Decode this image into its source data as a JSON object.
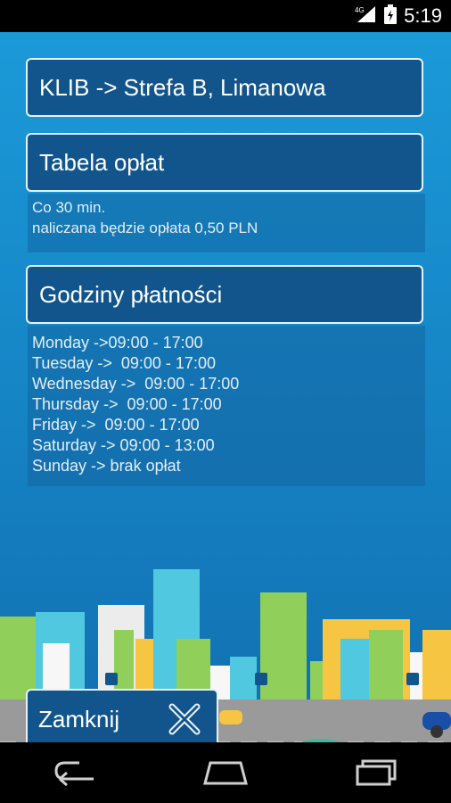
{
  "status_bar": {
    "time": "5:19",
    "network_label": "4G"
  },
  "route_title": "KLIB -> Strefa B, Limanowa",
  "fee_table": {
    "heading": "Tabela opłat",
    "line1": "Co 30 min.",
    "line2": "naliczana będzie opłata 0,50 PLN"
  },
  "payment_hours": {
    "heading": "Godziny płatności",
    "rows": [
      "Monday ->09:00 - 17:00",
      "Tuesday ->  09:00 - 17:00",
      "Wednesday ->  09:00 - 17:00",
      "Thursday ->  09:00 - 17:00",
      "Friday ->  09:00 - 17:00",
      "Saturday -> 09:00 - 13:00",
      "Sunday -> brak opłat"
    ]
  },
  "close_button": {
    "label": "Zamknij"
  },
  "colors": {
    "background": "#1b9ad8",
    "box": "#12558c",
    "border": "#e9f1f8",
    "road": "#9a9a9a"
  }
}
